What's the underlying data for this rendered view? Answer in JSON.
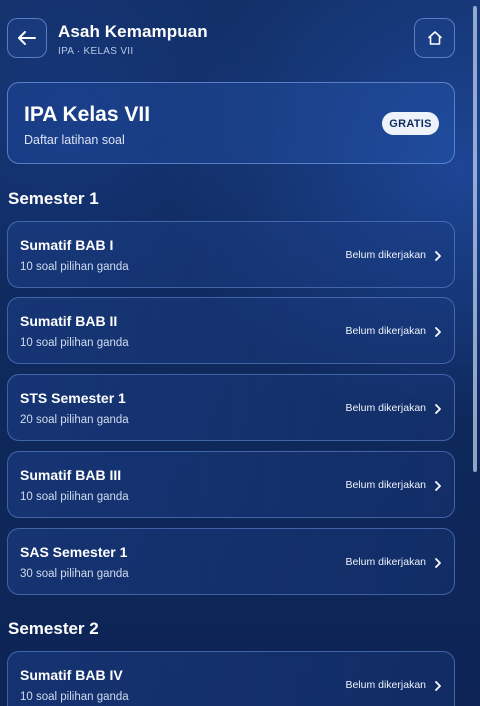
{
  "header": {
    "title": "Asah Kemampuan",
    "subtitle": "IPA · KELAS VII",
    "back_icon": "arrow-left-icon",
    "home_icon": "home-icon"
  },
  "hero": {
    "title": "IPA Kelas VII",
    "subtitle": "Daftar latihan soal",
    "badge": "GRATIS"
  },
  "sections": [
    {
      "title": "Semester 1",
      "items": [
        {
          "title": "Sumatif BAB I",
          "subtitle": "10 soal pilihan ganda",
          "status": "Belum dikerjakan"
        },
        {
          "title": "Sumatif BAB II",
          "subtitle": "10 soal pilihan ganda",
          "status": "Belum dikerjakan"
        },
        {
          "title": "STS Semester 1",
          "subtitle": "20 soal pilihan ganda",
          "status": "Belum dikerjakan"
        },
        {
          "title": "Sumatif BAB III",
          "subtitle": "10 soal pilihan ganda",
          "status": "Belum dikerjakan"
        },
        {
          "title": "SAS Semester 1",
          "subtitle": "30 soal pilihan ganda",
          "status": "Belum dikerjakan"
        }
      ]
    },
    {
      "title": "Semester 2",
      "items": [
        {
          "title": "Sumatif BAB IV",
          "subtitle": "10 soal pilihan ganda",
          "status": "Belum dikerjakan"
        }
      ]
    }
  ],
  "colors": {
    "background": "#0f2a5e",
    "accent": "#eef3fb",
    "border": "#6e96e1"
  }
}
